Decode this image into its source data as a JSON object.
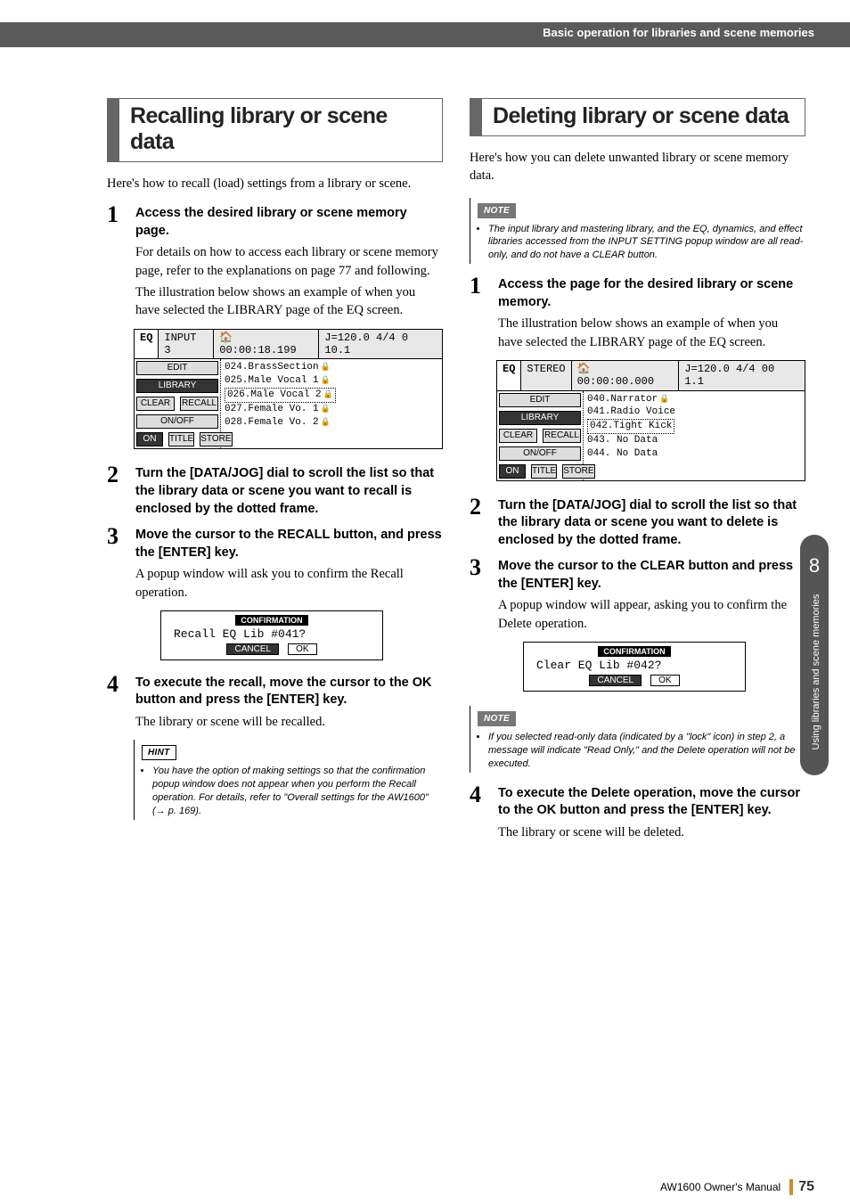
{
  "header": {
    "breadcrumb": "Basic operation for libraries and scene memories"
  },
  "left": {
    "title": "Recalling library or scene data",
    "intro": "Here's how to recall (load) settings from a library or scene.",
    "step1": {
      "head": "Access the desired library or scene memory page.",
      "body1": "For details on how to access each library or scene memory page, refer to the explanations on page 77 and following.",
      "body2": "The illustration below shows an example of when you have selected the LIBRARY page of the EQ screen."
    },
    "lib": {
      "top_a": "EQ",
      "top_b": "INPUT 3",
      "top_c": "🏠 00:00:18.199",
      "top_d": "J=120.0 4/4 0 10.1",
      "title": "EQ LIBRARY",
      "items": [
        "024.BrassSection",
        "025.Male Vocal 1",
        "026.Male Vocal 2",
        "027.Female Vo. 1",
        "028.Female Vo. 2"
      ],
      "btns": {
        "edit": "EDIT",
        "library": "LIBRARY",
        "clear": "CLEAR",
        "recall": "RECALL",
        "onoff": "ON/OFF",
        "on": "ON",
        "titleb": "TITLE",
        "store": "STORE"
      }
    },
    "step2": {
      "head": "Turn the [DATA/JOG] dial to scroll the list so that the library data or scene you want to recall is enclosed by the dotted frame."
    },
    "step3": {
      "head": "Move the cursor to the RECALL button, and press the [ENTER] key.",
      "body": "A popup window will ask you to confirm the Recall operation."
    },
    "dialog": {
      "title": "CONFIRMATION",
      "line": "Recall   EQ   Lib #041?",
      "cancel": "CANCEL",
      "ok": "OK"
    },
    "step4": {
      "head": "To execute the recall, move the cursor to the OK button and press the [ENTER] key.",
      "body": "The library or scene will be recalled."
    },
    "hint": {
      "tag": "HINT",
      "text": "You have the option of making settings so that the confirmation popup window does not appear when you perform the Recall operation. For details, refer to \"Overall settings for the AW1600\" (→ p. 169)."
    }
  },
  "right": {
    "title": "Deleting library or scene data",
    "intro": "Here's how you can delete unwanted library or scene memory data.",
    "note1": {
      "tag": "NOTE",
      "text": "The input library and mastering library, and the EQ, dynamics, and effect libraries accessed from the INPUT SETTING popup window are all read-only, and do not have a CLEAR button."
    },
    "step1": {
      "head": "Access the page for the desired library or scene memory.",
      "body": "The illustration below shows an example of when you have selected the LIBRARY page of the EQ screen."
    },
    "lib": {
      "top_a": "EQ",
      "top_b": "STEREO",
      "top_c": "🏠 00:00:00.000",
      "top_d": "J=120.0 4/4 00 1.1",
      "title": "EQ LIBRARY",
      "items": [
        "040.Narrator",
        "041.Radio Voice",
        "042.Tight Kick",
        "043.  No Data",
        "044.  No Data"
      ],
      "btns": {
        "edit": "EDIT",
        "library": "LIBRARY",
        "clear": "CLEAR",
        "recall": "RECALL",
        "onoff": "ON/OFF",
        "on": "ON",
        "titleb": "TITLE",
        "store": "STORE"
      }
    },
    "step2": {
      "head": "Turn the [DATA/JOG] dial to scroll the list so that the library data or scene you want to delete is enclosed by the dotted frame."
    },
    "step3": {
      "head": "Move the cursor to the CLEAR button and press the [ENTER] key.",
      "body": "A popup window will appear, asking you to confirm the Delete operation."
    },
    "dialog": {
      "title": "CONFIRMATION",
      "line": "Clear   EQ   Lib #042?",
      "cancel": "CANCEL",
      "ok": "OK"
    },
    "note2": {
      "tag": "NOTE",
      "text": "If you selected read-only data (indicated by a \"lock\" icon) in step 2, a message will indicate \"Read Only,\" and the Delete operation will not be executed."
    },
    "step4": {
      "head": "To execute the Delete operation, move the cursor to the OK button and press the [ENTER] key.",
      "body": "The library or scene will be deleted."
    }
  },
  "sidebar": {
    "num": "8",
    "label": "Using libraries and scene memories"
  },
  "footer": {
    "doc": "AW1600  Owner's Manual",
    "page": "75"
  }
}
